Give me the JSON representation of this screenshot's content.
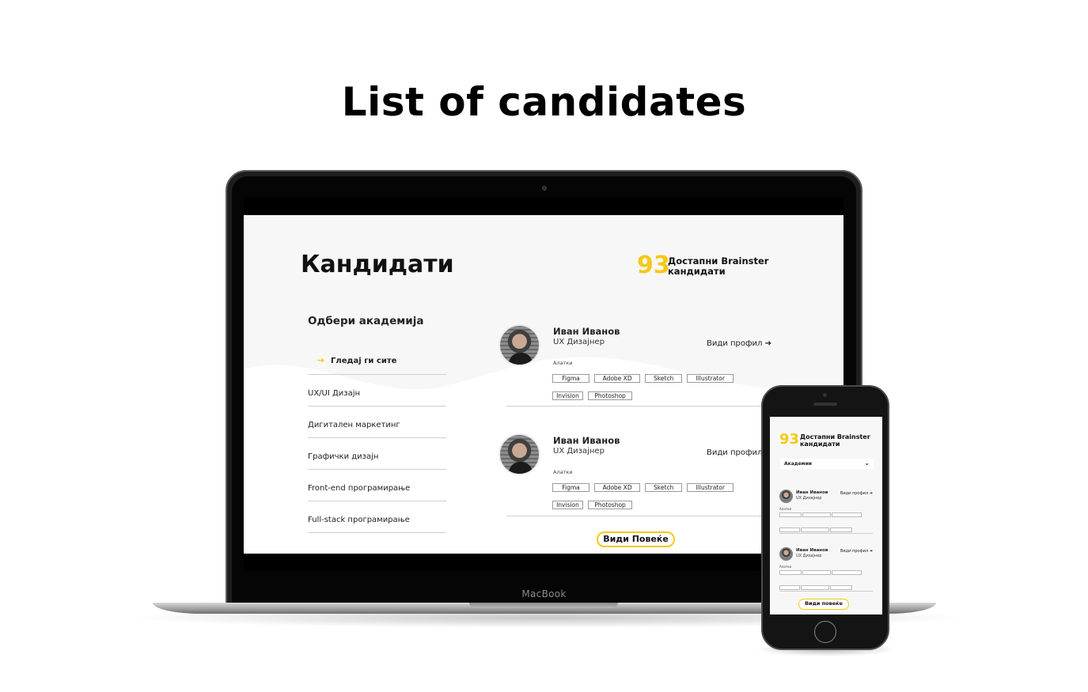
{
  "title": "List of candidates",
  "laptop": {
    "brand": "MacBook",
    "heading": "Кандидати",
    "count": "93",
    "count_label": "Достапни Brainster кандидати",
    "filter": {
      "title": "Одбери академија",
      "items": [
        {
          "label": "Гледај ги сите",
          "active": true
        },
        {
          "label": "UX/UI Дизајн"
        },
        {
          "label": "Дигитален маркетинг"
        },
        {
          "label": "Графички дизајн"
        },
        {
          "label": "Front-end програмирање"
        },
        {
          "label": "Full-stack програмирање"
        }
      ]
    },
    "candidates": [
      {
        "name": "Иван Иванов",
        "role": "UX Дизајнер",
        "profile_link": "Види профил",
        "tools_label": "Алатки",
        "tools": [
          "Figma",
          "Adobe XD",
          "Sketch",
          "Illustrator",
          "Invision",
          "Photoshop"
        ]
      },
      {
        "name": "Иван Иванов",
        "role": "UX Дизајнер",
        "profile_link": "Види профил",
        "tools_label": "Алатки",
        "tools": [
          "Figma",
          "Adobe XD",
          "Sketch",
          "Illustrator",
          "Invision",
          "Photoshop"
        ]
      }
    ],
    "more_button": "Види Повеќе"
  },
  "phone": {
    "count": "93",
    "count_label": "Достапни Brainster кандидати",
    "select_value": "Академии",
    "candidates": [
      {
        "name": "Иван Иванов",
        "role": "UX Дизајнер",
        "profile_link": "Види профил",
        "tools_label": "Алатки"
      },
      {
        "name": "Иван Иванов",
        "role": "UX Дизајнер",
        "profile_link": "Види профил",
        "tools_label": "Алатки"
      }
    ],
    "more_button": "Види повеќе"
  },
  "colors": {
    "accent": "#f4c917",
    "background": "#f7f7f7",
    "text": "#111111"
  },
  "icons": {
    "arrow": "arrow-right-icon",
    "chevron": "chevron-down-icon"
  }
}
